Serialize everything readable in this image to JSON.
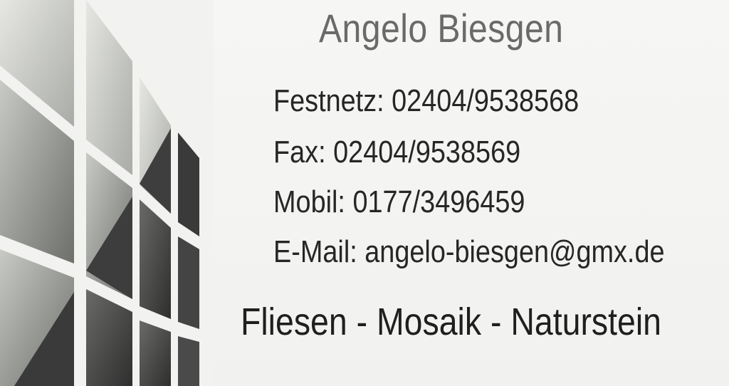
{
  "card": {
    "name": "Angelo Biesgen",
    "contacts": [
      {
        "label": "Festnetz:",
        "value": "02404/9538568"
      },
      {
        "label": "Fax:",
        "value": "02404/9538569"
      },
      {
        "label": "Mobil:",
        "value": "0177/3496459"
      },
      {
        "label": "E-Mail:",
        "value": "angelo-biesgen@gmx.de"
      }
    ],
    "tagline": "Fliesen - Mosaik - Naturstein"
  },
  "colors": {
    "background": "#f4f4f2",
    "name_text": "#6a6a6a",
    "body_text": "#262626",
    "tile_light": "#d9dbd6",
    "tile_mid": "#9a9c98",
    "tile_dark": "#3c3c3c"
  },
  "icons": {
    "logo": "tile-grid-logo"
  }
}
